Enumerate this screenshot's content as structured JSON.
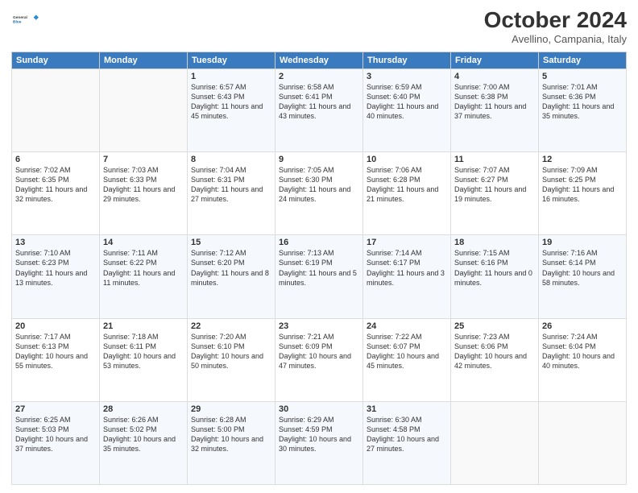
{
  "header": {
    "logo_line1": "General",
    "logo_line2": "Blue",
    "month": "October 2024",
    "location": "Avellino, Campania, Italy"
  },
  "weekdays": [
    "Sunday",
    "Monday",
    "Tuesday",
    "Wednesday",
    "Thursday",
    "Friday",
    "Saturday"
  ],
  "weeks": [
    [
      {
        "day": "",
        "info": ""
      },
      {
        "day": "",
        "info": ""
      },
      {
        "day": "1",
        "info": "Sunrise: 6:57 AM\nSunset: 6:43 PM\nDaylight: 11 hours and 45 minutes."
      },
      {
        "day": "2",
        "info": "Sunrise: 6:58 AM\nSunset: 6:41 PM\nDaylight: 11 hours and 43 minutes."
      },
      {
        "day": "3",
        "info": "Sunrise: 6:59 AM\nSunset: 6:40 PM\nDaylight: 11 hours and 40 minutes."
      },
      {
        "day": "4",
        "info": "Sunrise: 7:00 AM\nSunset: 6:38 PM\nDaylight: 11 hours and 37 minutes."
      },
      {
        "day": "5",
        "info": "Sunrise: 7:01 AM\nSunset: 6:36 PM\nDaylight: 11 hours and 35 minutes."
      }
    ],
    [
      {
        "day": "6",
        "info": "Sunrise: 7:02 AM\nSunset: 6:35 PM\nDaylight: 11 hours and 32 minutes."
      },
      {
        "day": "7",
        "info": "Sunrise: 7:03 AM\nSunset: 6:33 PM\nDaylight: 11 hours and 29 minutes."
      },
      {
        "day": "8",
        "info": "Sunrise: 7:04 AM\nSunset: 6:31 PM\nDaylight: 11 hours and 27 minutes."
      },
      {
        "day": "9",
        "info": "Sunrise: 7:05 AM\nSunset: 6:30 PM\nDaylight: 11 hours and 24 minutes."
      },
      {
        "day": "10",
        "info": "Sunrise: 7:06 AM\nSunset: 6:28 PM\nDaylight: 11 hours and 21 minutes."
      },
      {
        "day": "11",
        "info": "Sunrise: 7:07 AM\nSunset: 6:27 PM\nDaylight: 11 hours and 19 minutes."
      },
      {
        "day": "12",
        "info": "Sunrise: 7:09 AM\nSunset: 6:25 PM\nDaylight: 11 hours and 16 minutes."
      }
    ],
    [
      {
        "day": "13",
        "info": "Sunrise: 7:10 AM\nSunset: 6:23 PM\nDaylight: 11 hours and 13 minutes."
      },
      {
        "day": "14",
        "info": "Sunrise: 7:11 AM\nSunset: 6:22 PM\nDaylight: 11 hours and 11 minutes."
      },
      {
        "day": "15",
        "info": "Sunrise: 7:12 AM\nSunset: 6:20 PM\nDaylight: 11 hours and 8 minutes."
      },
      {
        "day": "16",
        "info": "Sunrise: 7:13 AM\nSunset: 6:19 PM\nDaylight: 11 hours and 5 minutes."
      },
      {
        "day": "17",
        "info": "Sunrise: 7:14 AM\nSunset: 6:17 PM\nDaylight: 11 hours and 3 minutes."
      },
      {
        "day": "18",
        "info": "Sunrise: 7:15 AM\nSunset: 6:16 PM\nDaylight: 11 hours and 0 minutes."
      },
      {
        "day": "19",
        "info": "Sunrise: 7:16 AM\nSunset: 6:14 PM\nDaylight: 10 hours and 58 minutes."
      }
    ],
    [
      {
        "day": "20",
        "info": "Sunrise: 7:17 AM\nSunset: 6:13 PM\nDaylight: 10 hours and 55 minutes."
      },
      {
        "day": "21",
        "info": "Sunrise: 7:18 AM\nSunset: 6:11 PM\nDaylight: 10 hours and 53 minutes."
      },
      {
        "day": "22",
        "info": "Sunrise: 7:20 AM\nSunset: 6:10 PM\nDaylight: 10 hours and 50 minutes."
      },
      {
        "day": "23",
        "info": "Sunrise: 7:21 AM\nSunset: 6:09 PM\nDaylight: 10 hours and 47 minutes."
      },
      {
        "day": "24",
        "info": "Sunrise: 7:22 AM\nSunset: 6:07 PM\nDaylight: 10 hours and 45 minutes."
      },
      {
        "day": "25",
        "info": "Sunrise: 7:23 AM\nSunset: 6:06 PM\nDaylight: 10 hours and 42 minutes."
      },
      {
        "day": "26",
        "info": "Sunrise: 7:24 AM\nSunset: 6:04 PM\nDaylight: 10 hours and 40 minutes."
      }
    ],
    [
      {
        "day": "27",
        "info": "Sunrise: 6:25 AM\nSunset: 5:03 PM\nDaylight: 10 hours and 37 minutes."
      },
      {
        "day": "28",
        "info": "Sunrise: 6:26 AM\nSunset: 5:02 PM\nDaylight: 10 hours and 35 minutes."
      },
      {
        "day": "29",
        "info": "Sunrise: 6:28 AM\nSunset: 5:00 PM\nDaylight: 10 hours and 32 minutes."
      },
      {
        "day": "30",
        "info": "Sunrise: 6:29 AM\nSunset: 4:59 PM\nDaylight: 10 hours and 30 minutes."
      },
      {
        "day": "31",
        "info": "Sunrise: 6:30 AM\nSunset: 4:58 PM\nDaylight: 10 hours and 27 minutes."
      },
      {
        "day": "",
        "info": ""
      },
      {
        "day": "",
        "info": ""
      }
    ]
  ]
}
